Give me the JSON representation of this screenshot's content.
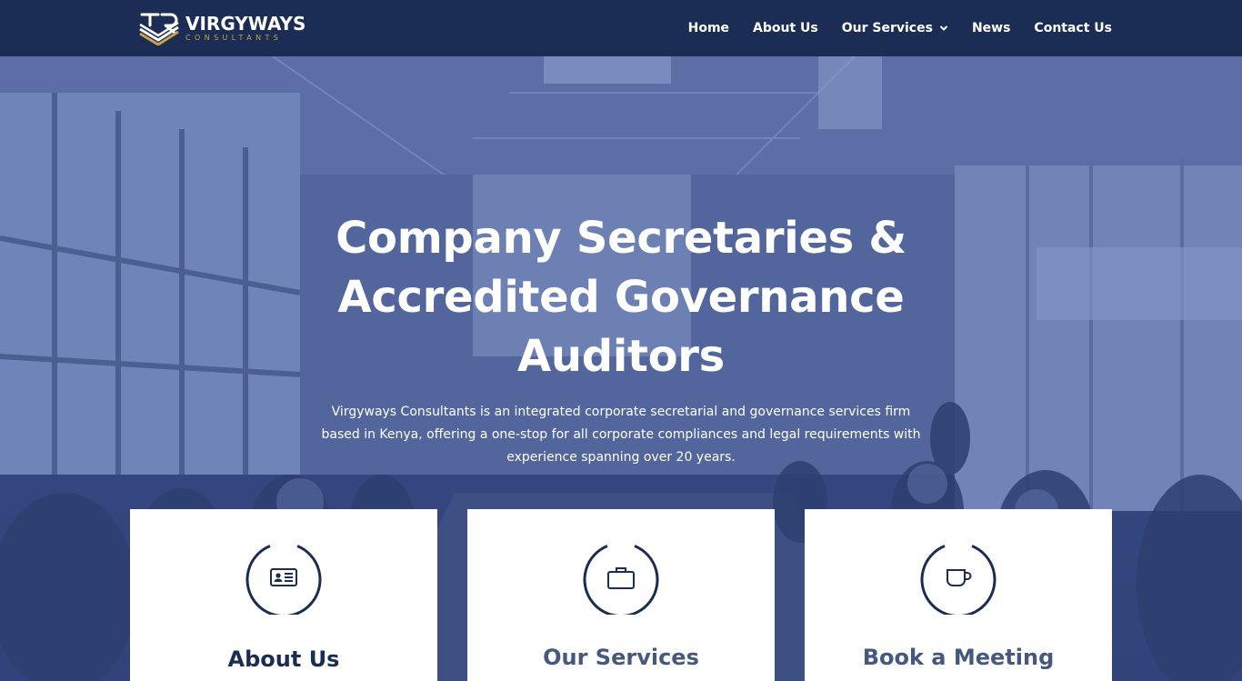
{
  "brand": {
    "name": "VIRGYWAYS",
    "tagline": "CONSULTANTS",
    "logo_icon": "vw-monogram-icon",
    "primary_color": "#1b2d55",
    "accent_color": "#c9a24a"
  },
  "nav": {
    "items": [
      {
        "label": "Home"
      },
      {
        "label": "About Us"
      },
      {
        "label": "Our Services",
        "has_dropdown": true
      },
      {
        "label": "News"
      },
      {
        "label": "Contact Us"
      }
    ]
  },
  "hero": {
    "title": "Company Secretaries & Accredited Governance Auditors",
    "description": "Virgyways Consultants is an integrated corporate secretarial and governance services firm based in Kenya, offering a one-stop for all corporate compliances and legal requirements with experience spanning over 20 years."
  },
  "cards": [
    {
      "title": "About Us",
      "icon": "id-card-icon"
    },
    {
      "title": "Our Services",
      "icon": "briefcase-icon"
    },
    {
      "title": "Book a Meeting",
      "icon": "coffee-cup-icon"
    }
  ]
}
